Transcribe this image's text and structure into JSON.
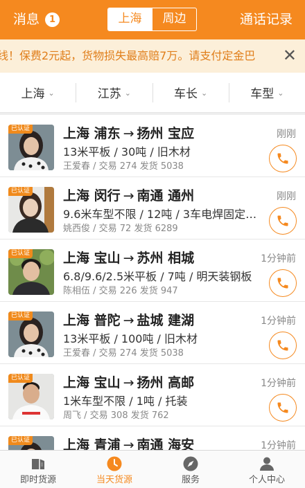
{
  "header": {
    "messages_label": "消息",
    "messages_count": "1",
    "region_tabs": [
      "上海",
      "周边"
    ],
    "call_log_label": "通话记录"
  },
  "notice": {
    "text": "线！保费2元起，货物损失最高赔7万。请支付定金巴",
    "close": "✕"
  },
  "filters": [
    {
      "label": "上海"
    },
    {
      "label": "江苏"
    },
    {
      "label": "车长"
    },
    {
      "label": "车型"
    }
  ],
  "colors": {
    "accent": "#f5891f",
    "notice_bg": "#fcefd9",
    "notice_text": "#e07e1a"
  },
  "verified_label": "已认证",
  "route_arrow": "→",
  "listings": [
    {
      "from": "上海 浦东",
      "to": "扬州 宝应",
      "desc": "13米平板 / 30吨 / 旧木材",
      "meta": "王爱春 / 交易 274 发货 5038",
      "time": "刚刚",
      "avatar_icon": "woman-avatar-icon"
    },
    {
      "from": "上海 闵行",
      "to": "南通 通州",
      "desc": "9.6米车型不限 / 12吨 / 3车电焊固定…",
      "meta": "姚西俊 / 交易 72 发货 6289",
      "time": "刚刚",
      "avatar_icon": "woman-avatar-icon"
    },
    {
      "from": "上海 宝山",
      "to": "苏州 相城",
      "desc": "6.8/9.6/2.5米平板 / 7吨 / 明天装钢板",
      "meta": "陈相伍 / 交易 226 发货 947",
      "time": "1分钟前",
      "avatar_icon": "man-avatar-icon"
    },
    {
      "from": "上海 普陀",
      "to": "盐城 建湖",
      "desc": "13米平板 / 100吨 / 旧木材",
      "meta": "王爱春 / 交易 274 发货 5038",
      "time": "1分钟前",
      "avatar_icon": "woman-avatar-icon"
    },
    {
      "from": "上海 宝山",
      "to": "扬州 高邮",
      "desc": "1米车型不限 / 1吨 / 托装",
      "meta": "周飞 / 交易 308 发货 762",
      "time": "1分钟前",
      "avatar_icon": "man-avatar-icon"
    },
    {
      "from": "上海 青浦",
      "to": "南通 海安",
      "desc": "",
      "meta": "",
      "time": "1分钟前",
      "avatar_icon": "woman-avatar-icon"
    }
  ],
  "tabbar": [
    {
      "label": "即时货源",
      "icon": "box-icon",
      "active": false
    },
    {
      "label": "当天货源",
      "icon": "clock-icon",
      "active": true
    },
    {
      "label": "服务",
      "icon": "compass-icon",
      "active": false
    },
    {
      "label": "个人中心",
      "icon": "person-icon",
      "active": false
    }
  ]
}
